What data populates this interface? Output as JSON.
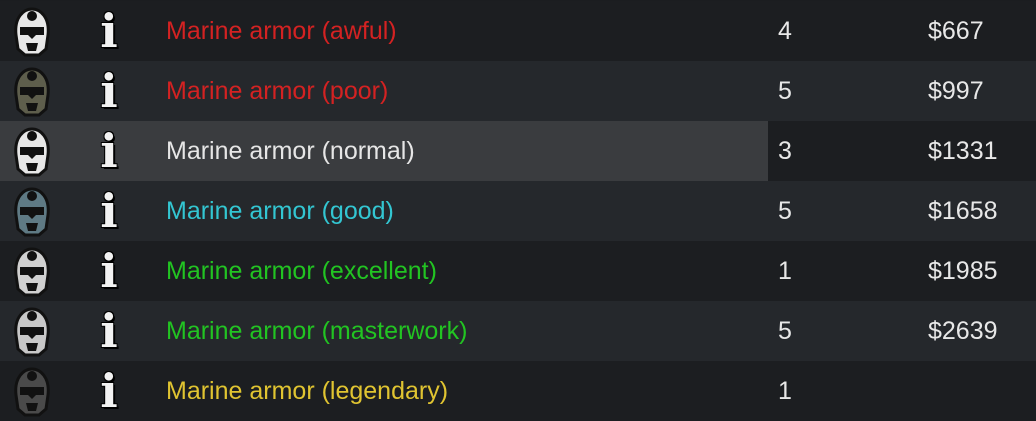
{
  "items": [
    {
      "name": "Marine armor (awful)",
      "count": "4",
      "price": "$667",
      "name_color": "#d42222",
      "helmet_color": "#e8e8e8",
      "highlighted": false
    },
    {
      "name": "Marine armor (poor)",
      "count": "5",
      "price": "$997",
      "name_color": "#d42222",
      "helmet_color": "#5e5e4c",
      "highlighted": false
    },
    {
      "name": "Marine armor (normal)",
      "count": "3",
      "price": "$1331",
      "name_color": "#e6e6e6",
      "helmet_color": "#e8e8e8",
      "highlighted": true
    },
    {
      "name": "Marine armor (good)",
      "count": "5",
      "price": "$1658",
      "name_color": "#33c6d2",
      "helmet_color": "#5f7a84",
      "highlighted": false
    },
    {
      "name": "Marine armor (excellent)",
      "count": "1",
      "price": "$1985",
      "name_color": "#22c422",
      "helmet_color": "#d0d0d0",
      "highlighted": false
    },
    {
      "name": "Marine armor (masterwork)",
      "count": "5",
      "price": "$2639",
      "name_color": "#22c422",
      "helmet_color": "#c8c8c8",
      "highlighted": false
    },
    {
      "name": "Marine armor (legendary)",
      "count": "1",
      "price": "",
      "name_color": "#e0c431",
      "helmet_color": "#4a4a4a",
      "highlighted": false
    }
  ],
  "icons": {
    "helmet": "marine-helmet-icon",
    "info": "info-icon"
  },
  "info_glyph": "i"
}
